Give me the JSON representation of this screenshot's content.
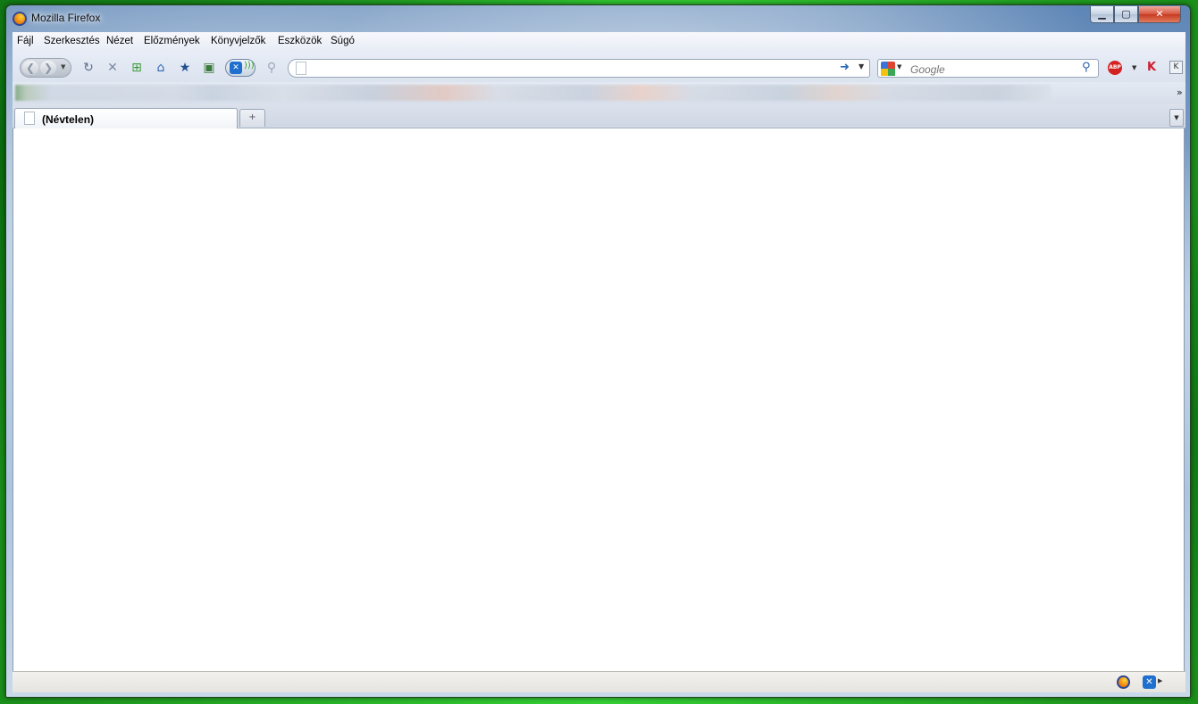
{
  "window": {
    "title": "Mozilla Firefox"
  },
  "window_controls": {
    "minimize": "▁",
    "maximize": "▢",
    "close": "✕"
  },
  "menu": {
    "items": [
      "Fájl",
      "Szerkesztés",
      "Nézet",
      "Előzmények",
      "Könyvjelzők",
      "Eszközök",
      "Súgó"
    ]
  },
  "toolbar": {
    "icons": [
      "back-icon",
      "forward-icon",
      "history-dropdown-icon",
      "reload-icon",
      "stop-icon",
      "new-page-icon",
      "home-icon",
      "bookmark-star-icon",
      "screenshot-icon",
      "xmarks-sync-icon",
      "search-magnifier-icon"
    ],
    "url": {
      "value": "",
      "placeholder": ""
    },
    "search": {
      "engine": "Google",
      "value": "",
      "placeholder": "Google"
    },
    "addons": [
      "abp-icon",
      "kaspersky-icon",
      "k-button-icon"
    ]
  },
  "bookmarks_bar": {
    "overflow": "»"
  },
  "tabs": [
    {
      "label": "(Névtelen)",
      "active": true
    }
  ],
  "new_tab": "+",
  "statusbar": {
    "text": ""
  },
  "colors": {
    "accent": "#5e86b6",
    "desktop": "#1fae1f",
    "close": "#c53a22"
  }
}
